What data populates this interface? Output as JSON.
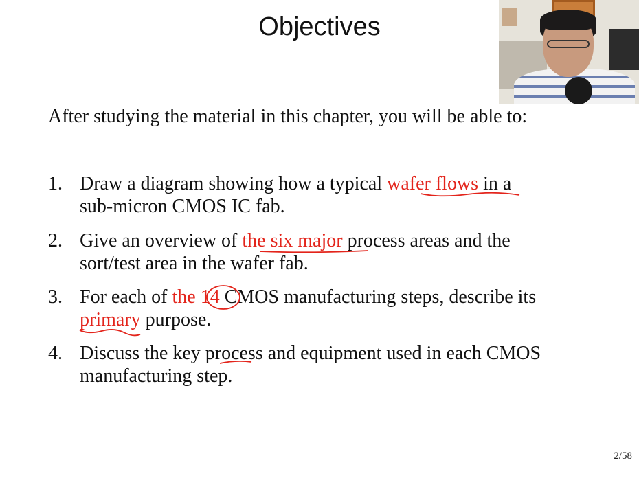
{
  "slide": {
    "title": "Objectives",
    "intro": "After studying the material in this chapter, you will be able to:",
    "page_number": "2/58"
  },
  "objectives": [
    {
      "number": "1.",
      "line1_a": "Draw a diagram showing how a typical ",
      "line1_hl": "wafer flows",
      "line1_b": " in a",
      "line2": "sub-micron CMOS IC fab."
    },
    {
      "number": "2.",
      "line1_a": "Give an overview of ",
      "line1_hl": "the six major",
      "line1_b": " process areas and the",
      "line2": "sort/test area in the wafer fab."
    },
    {
      "number": "3.",
      "line1_a": "For each of ",
      "line1_hl": "the 14",
      "line1_b": " CMOS manufacturing steps, describe its",
      "line2_hl": "primary",
      "line2_b": " purpose."
    },
    {
      "number": "4.",
      "line1": "Discuss the key process and equipment used in each CMOS",
      "line2": "manufacturing step."
    }
  ],
  "colors": {
    "text": "#111111",
    "highlight": "#e3241b",
    "background": "#ffffff"
  }
}
